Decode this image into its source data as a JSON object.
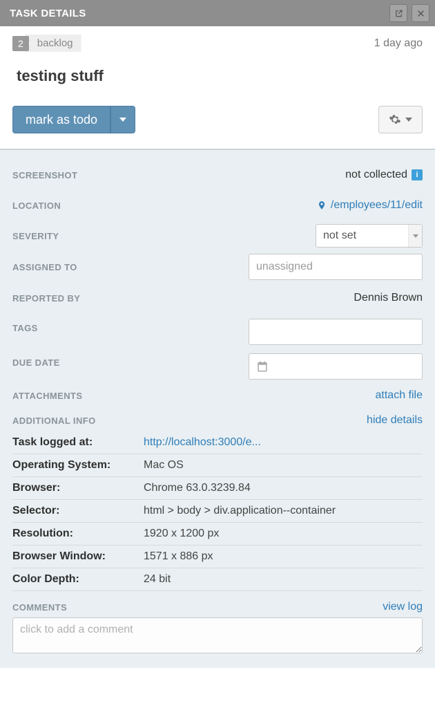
{
  "titlebar": {
    "title": "TASK DETAILS"
  },
  "header": {
    "id": "2",
    "stage": "backlog",
    "time": "1 day ago",
    "task_title": "testing stuff",
    "mark_btn": "mark as todo"
  },
  "details": {
    "screenshot_label": "SCREENSHOT",
    "screenshot_value": "not collected",
    "location_label": "LOCATION",
    "location_value": "/employees/11/edit",
    "severity_label": "SEVERITY",
    "severity_value": "not set",
    "assigned_label": "ASSIGNED TO",
    "assigned_placeholder": "unassigned",
    "reported_label": "REPORTED BY",
    "reported_value": "Dennis Brown",
    "tags_label": "TAGS",
    "duedate_label": "DUE DATE",
    "attachments_label": "ATTACHMENTS",
    "attachments_action": "attach file",
    "additional_label": "ADDITIONAL INFO",
    "additional_action": "hide details",
    "info": {
      "logged_at_label": "Task logged at:",
      "logged_at_value": "http://localhost:3000/e...",
      "os_label": "Operating System:",
      "os_value": "Mac OS",
      "browser_label": "Browser:",
      "browser_value": "Chrome 63.0.3239.84",
      "selector_label": "Selector:",
      "selector_value": "html > body > div.application--container",
      "resolution_label": "Resolution:",
      "resolution_value": "1920 x 1200 px",
      "window_label": "Browser Window:",
      "window_value": "1571 x 886 px",
      "depth_label": "Color Depth:",
      "depth_value": "24 bit"
    },
    "comments_label": "COMMENTS",
    "comments_action": "view log",
    "comments_placeholder": "click to add a comment"
  }
}
